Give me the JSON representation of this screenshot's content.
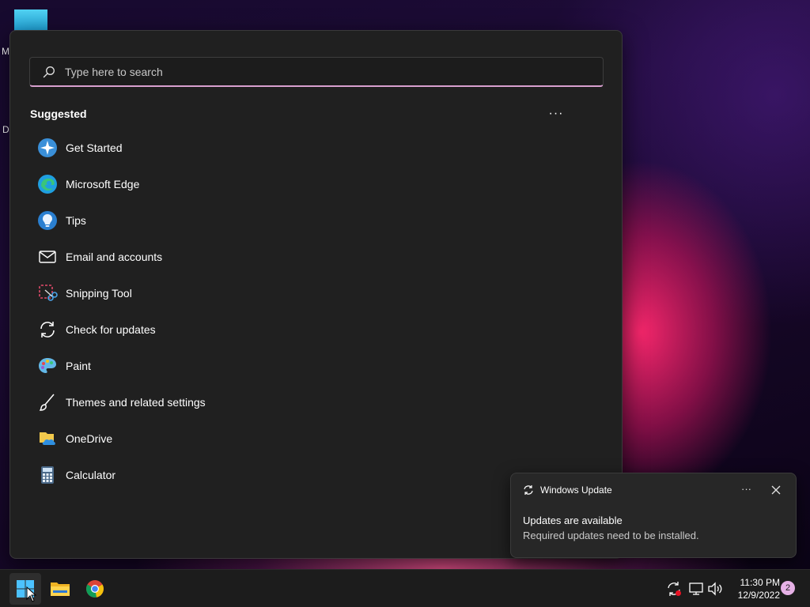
{
  "desktop": {
    "label_fragment_1": "M",
    "label_fragment_2": "D"
  },
  "start_menu": {
    "search": {
      "placeholder": "Type here to search",
      "value": ""
    },
    "suggested_title": "Suggested",
    "more_label": "···",
    "items": [
      {
        "label": "Get Started",
        "icon": "get-started-icon"
      },
      {
        "label": "Microsoft Edge",
        "icon": "edge-icon"
      },
      {
        "label": "Tips",
        "icon": "tips-icon"
      },
      {
        "label": "Email and accounts",
        "icon": "mail-icon"
      },
      {
        "label": "Snipping Tool",
        "icon": "snipping-tool-icon"
      },
      {
        "label": "Check for updates",
        "icon": "update-icon"
      },
      {
        "label": "Paint",
        "icon": "paint-icon"
      },
      {
        "label": "Themes and related settings",
        "icon": "brush-icon"
      },
      {
        "label": "OneDrive",
        "icon": "onedrive-icon"
      },
      {
        "label": "Calculator",
        "icon": "calculator-icon"
      }
    ]
  },
  "notification": {
    "app": "Windows Update",
    "more_label": "···",
    "title": "Updates are available",
    "body": "Required updates need to be installed."
  },
  "taskbar": {
    "apps": [
      "start-icon",
      "file-explorer-icon",
      "chrome-icon"
    ],
    "clock_time": "11:30 PM",
    "clock_date": "12/9/2022",
    "notification_count": "2"
  },
  "colors": {
    "menu_bg": "#202020",
    "accent": "#d8a0cf",
    "taskbar_bg": "#1c1c1c",
    "badge": "#e6b1e6"
  }
}
